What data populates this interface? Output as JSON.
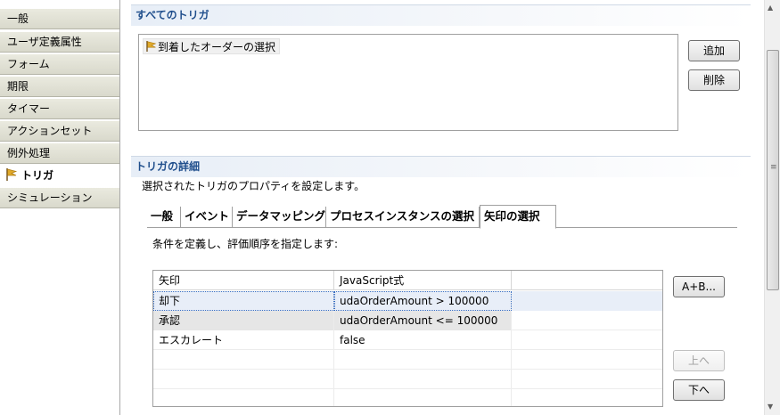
{
  "nav": {
    "items": [
      {
        "label": "一般"
      },
      {
        "label": "ユーザ定義属性"
      },
      {
        "label": "フォーム"
      },
      {
        "label": "期限"
      },
      {
        "label": "タイマー"
      },
      {
        "label": "アクションセット"
      },
      {
        "label": "例外処理"
      },
      {
        "label": "トリガ",
        "active": true
      },
      {
        "label": "シミュレーション"
      }
    ]
  },
  "all_triggers": {
    "title": "すべてのトリガ",
    "items": [
      "到着したオーダーの選択"
    ],
    "add_label": "追加",
    "delete_label": "削除"
  },
  "trigger_details": {
    "title": "トリガの詳細",
    "description": "選択されたトリガのプロパティを設定します。",
    "tabs": [
      "一般",
      "イベント",
      "データマッピング",
      "プロセスインスタンスの選択",
      "矢印の選択"
    ],
    "active_tab": "矢印の選択",
    "instruction": "条件を定義し、評価順序を指定します:",
    "table": {
      "headers": [
        "矢印",
        "JavaScript式",
        ""
      ],
      "rows": [
        {
          "arrow": "却下",
          "expr": "udaOrderAmount > 100000"
        },
        {
          "arrow": "承認",
          "expr": "udaOrderAmount <= 100000"
        },
        {
          "arrow": "エスカレート",
          "expr": "false"
        }
      ]
    },
    "expr_button_label": "A+B...",
    "up_label": "上へ",
    "down_label": "下へ"
  },
  "colors": {
    "section_title": "#1f4e8c",
    "selection": "#e8eef8",
    "flag": "#d9a520"
  }
}
